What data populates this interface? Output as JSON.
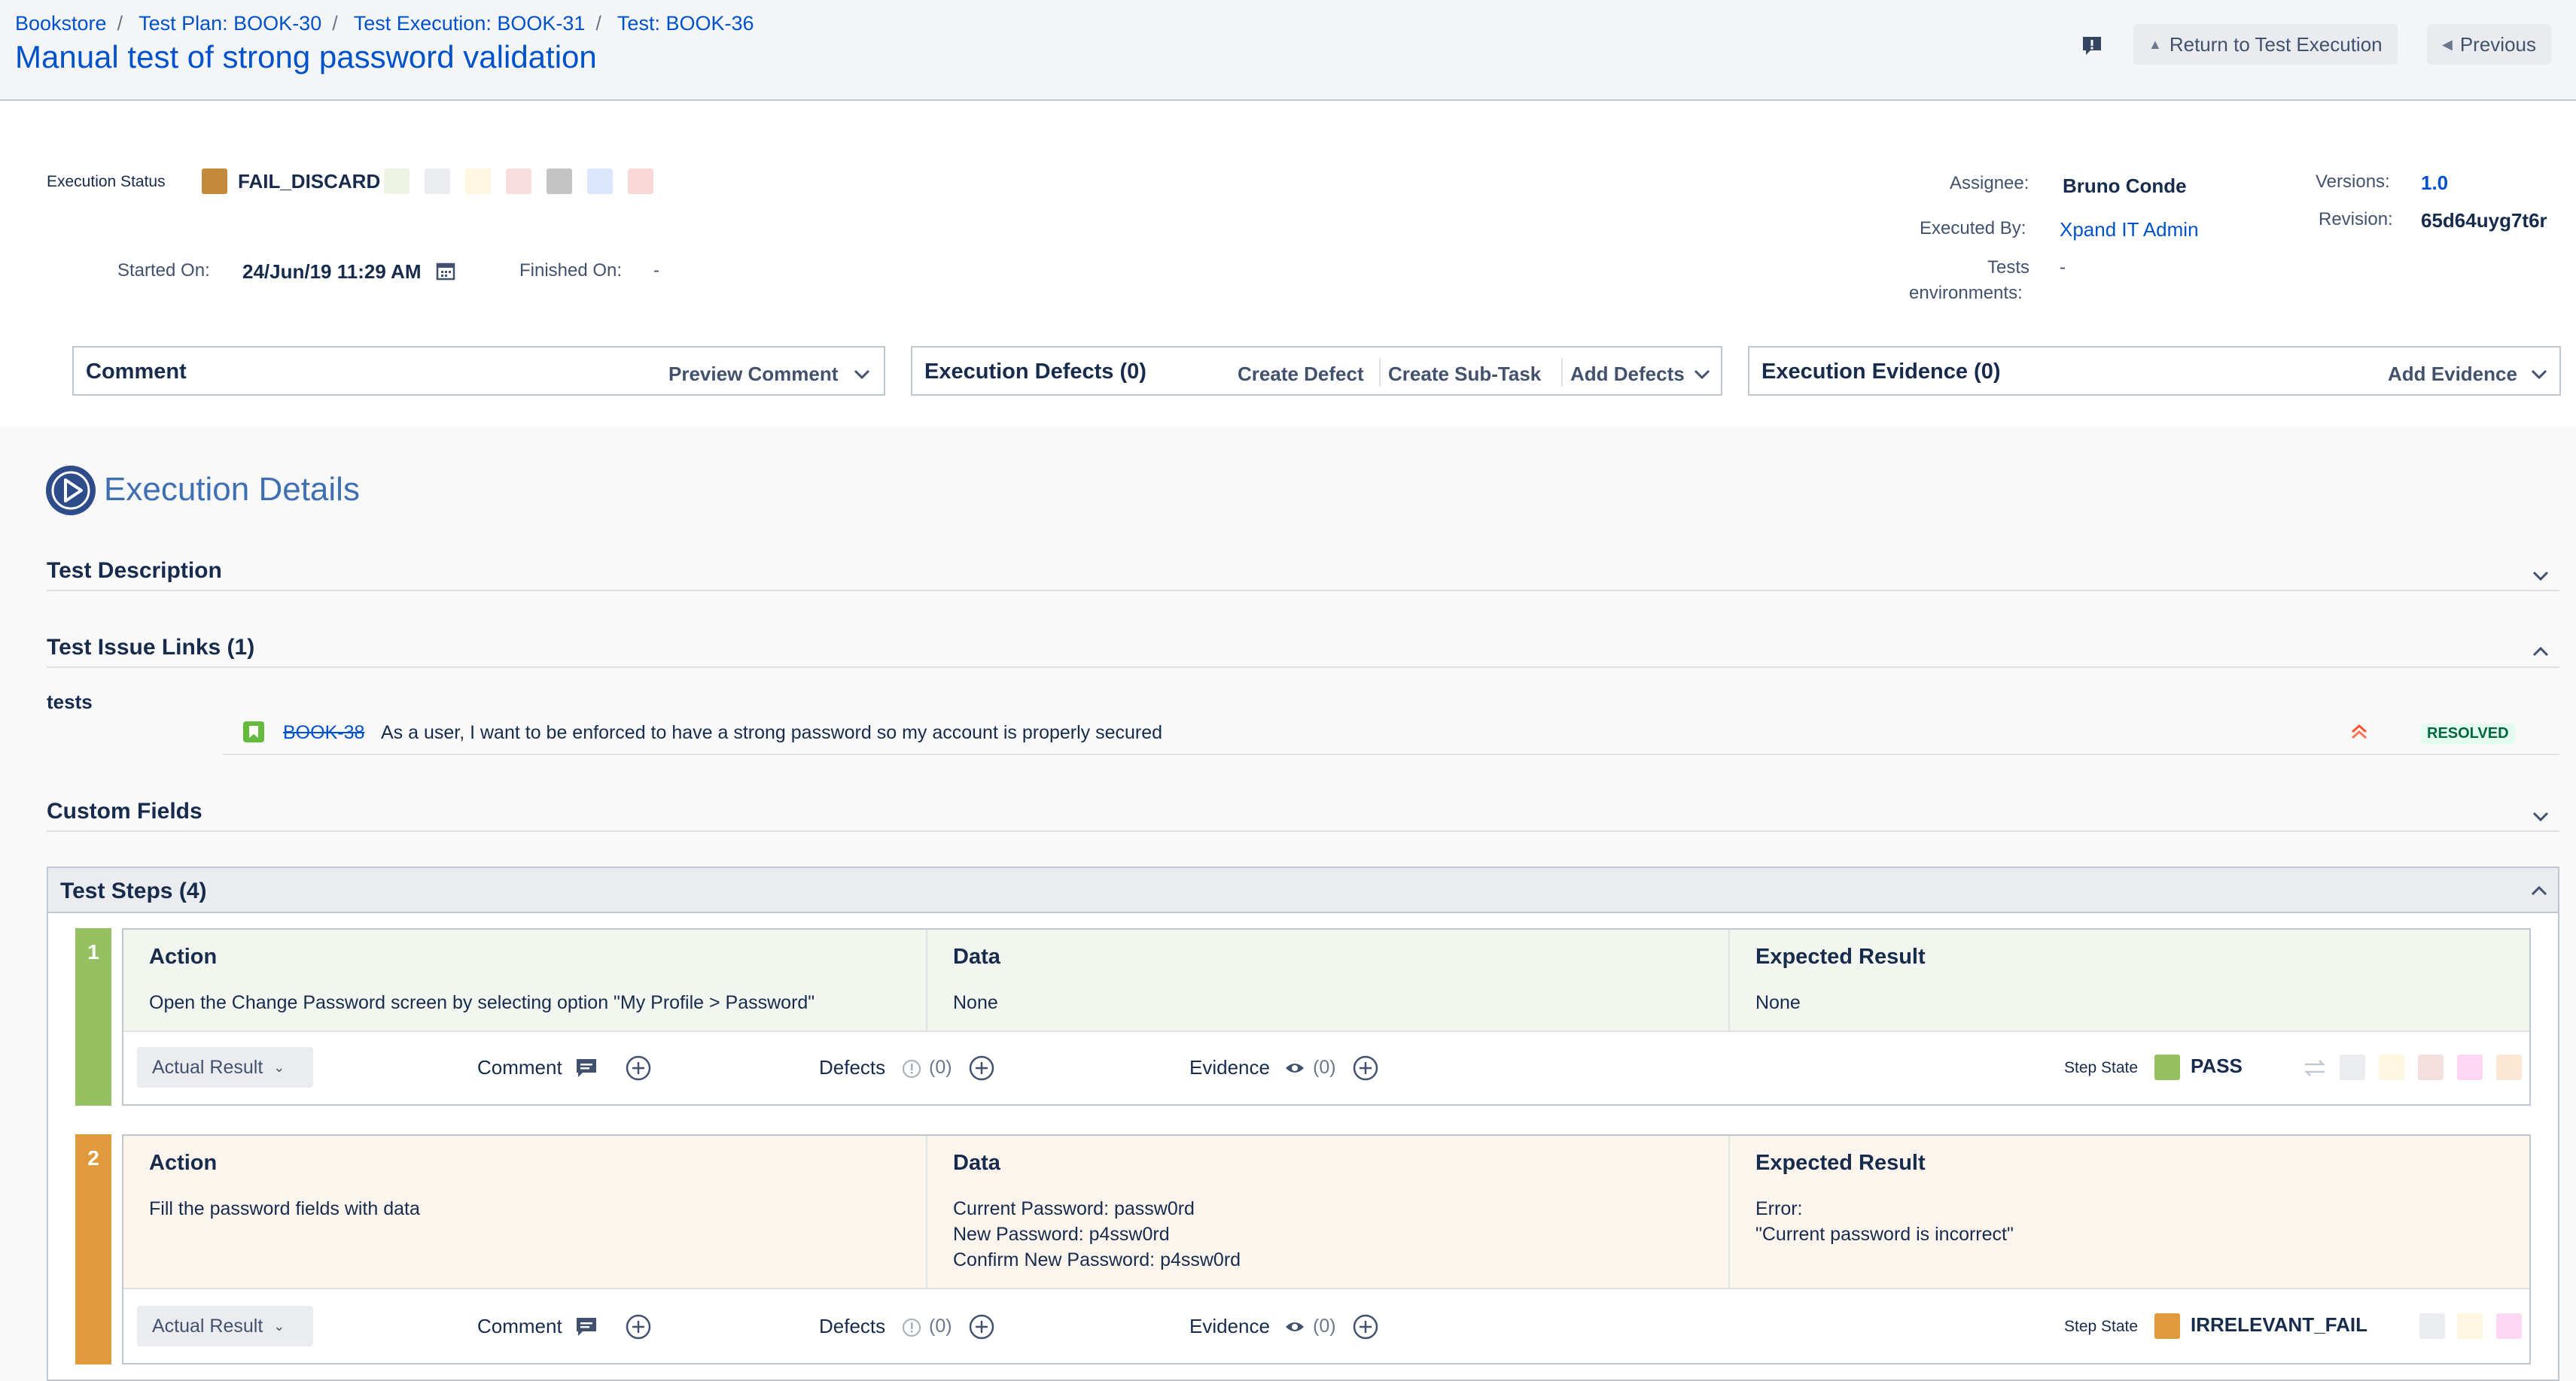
{
  "breadcrumbs": [
    "Bookstore",
    "Test Plan: BOOK-30",
    "Test Execution: BOOK-31",
    "Test: BOOK-36"
  ],
  "page_title": "Manual test of strong password validation",
  "header_buttons": {
    "return_label": "Return to Test Execution",
    "previous_label": "Previous"
  },
  "status": {
    "label": "Execution Status",
    "value": "FAIL_DISCARD",
    "value_color": "#c28a3a",
    "swatches": [
      "#eef3e2",
      "#ebecf0",
      "#fdf7e1",
      "#f8dede",
      "#c4c4c4",
      "#dbe6fd",
      "#f9d8d8"
    ]
  },
  "dates": {
    "started_label": "Started On:",
    "started_value": "24/Jun/19 11:29 AM",
    "finished_label": "Finished On:",
    "finished_value": "-"
  },
  "meta": {
    "assignee_label": "Assignee:",
    "assignee_value": "Bruno Conde",
    "executed_by_label": "Executed By:",
    "executed_by_value": "Xpand IT Admin",
    "env_label_1": "Tests",
    "env_label_2": "environments:",
    "env_value": "-",
    "versions_label": "Versions:",
    "versions_value": "1.0",
    "revision_label": "Revision:",
    "revision_value": "65d64uyg7t6r"
  },
  "panels": {
    "comment": {
      "title": "Comment",
      "action": "Preview Comment"
    },
    "defects": {
      "title": "Execution Defects (0)",
      "actions": [
        "Create Defect",
        "Create Sub-Task",
        "Add Defects"
      ]
    },
    "evidence": {
      "title": "Execution Evidence (0)",
      "action": "Add Evidence"
    }
  },
  "details": {
    "title": "Execution Details",
    "test_description": "Test Description",
    "issue_links_title": "Test Issue Links (1)",
    "link_type": "tests",
    "link": {
      "key": "BOOK-38",
      "summary": "As a user, I want to be enforced to have a strong password so my account is properly secured",
      "status": "RESOLVED"
    },
    "custom_fields": "Custom Fields"
  },
  "steps": {
    "title": "Test Steps (4)",
    "col_action": "Action",
    "col_data": "Data",
    "col_expected": "Expected Result",
    "actual_result": "Actual Result",
    "comment_label": "Comment",
    "defects_label": "Defects",
    "evidence_label": "Evidence",
    "step_state_label": "Step State",
    "items": [
      {
        "num": "1",
        "action": "Open the Change Password screen by selecting option \"My Profile > Password\"",
        "data": [
          "None"
        ],
        "expected": [
          "None"
        ],
        "defects_count": "(0)",
        "evidence_count": "(0)",
        "state": "PASS",
        "state_color": "#95c160",
        "bar_color": "#95c160"
      },
      {
        "num": "2",
        "action": "Fill the password fields with data",
        "data": [
          "Current Password: passw0rd",
          "New Password: p4ssw0rd",
          "Confirm New Password: p4ssw0rd"
        ],
        "expected": [
          "Error:",
          "\"Current password is incorrect\""
        ],
        "defects_count": "(0)",
        "evidence_count": "(0)",
        "state": "IRRELEVANT_FAIL",
        "state_color": "#e09a3b",
        "bar_color": "#e09a3b"
      }
    ]
  }
}
